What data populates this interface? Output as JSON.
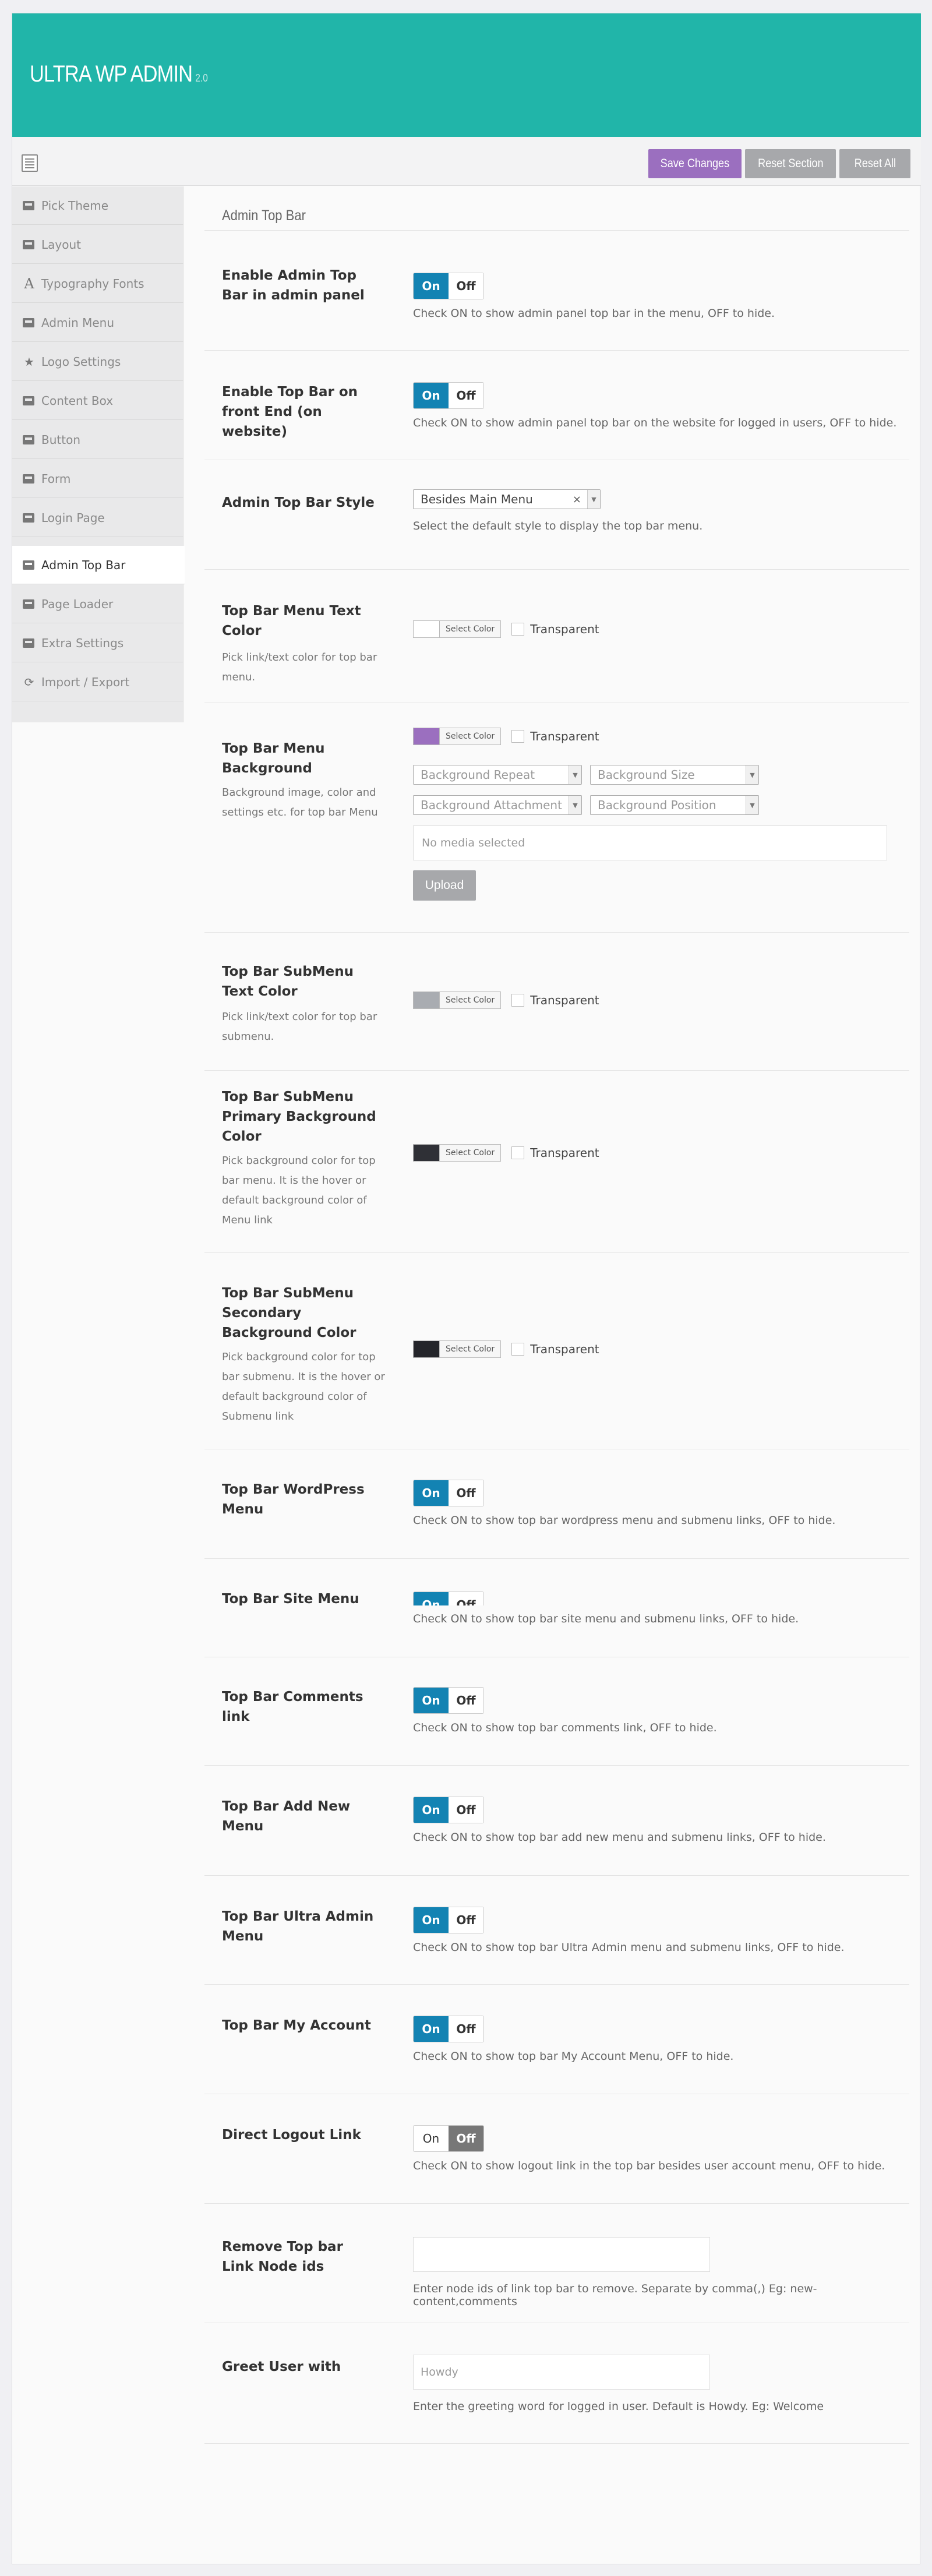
{
  "header": {
    "title": "ULTRA WP ADMIN",
    "version": "2.0"
  },
  "toolbar": {
    "save_label": "Save Changes",
    "reset_section_label": "Reset Section",
    "reset_all_label": "Reset All"
  },
  "sidebar": {
    "items": [
      {
        "label": "Pick Theme",
        "icon": "screen-icon"
      },
      {
        "label": "Layout",
        "icon": "screen-icon"
      },
      {
        "label": "Typography Fonts",
        "icon": "font-icon"
      },
      {
        "label": "Admin Menu",
        "icon": "screen-icon"
      },
      {
        "label": "Logo Settings",
        "icon": "star-icon"
      },
      {
        "label": "Content Box",
        "icon": "screen-icon"
      },
      {
        "label": "Button",
        "icon": "screen-icon"
      },
      {
        "label": "Form",
        "icon": "screen-icon"
      },
      {
        "label": "Login Page",
        "icon": "screen-icon"
      },
      {
        "label": "Admin Top Bar",
        "icon": "screen-icon",
        "active": true
      },
      {
        "label": "Page Loader",
        "icon": "screen-icon"
      },
      {
        "label": "Extra Settings",
        "icon": "screen-icon"
      },
      {
        "label": "Import / Export",
        "icon": "refresh-icon"
      }
    ]
  },
  "main": {
    "section_title": "Admin Top Bar",
    "fields": {
      "enable_admin": {
        "label": "Enable Admin Top Bar in admin panel",
        "help": "Check ON to show admin panel top bar in the menu, OFF to hide.",
        "on": "On",
        "off": "Off",
        "state": "on"
      },
      "enable_front": {
        "label": "Enable Top Bar on front End (on website)",
        "help": "Check ON to show admin panel top bar on the website for logged in users, OFF to hide.",
        "on": "On",
        "off": "Off",
        "state": "on"
      },
      "style": {
        "label": "Admin Top Bar Style",
        "value": "Besides Main Menu",
        "help": "Select the default style to display the top bar menu."
      },
      "menu_text_color": {
        "label": "Top Bar Menu Text Color",
        "desc": "Pick link/text color for top bar menu.",
        "color": "#ffffff",
        "select": "Select Color",
        "transparent": "Transparent"
      },
      "menu_bg": {
        "label": "Top Bar Menu Background",
        "desc": "Background image, color and settings etc. for top bar Menu",
        "color": "#9b6fbf",
        "select": "Select Color",
        "transparent": "Transparent",
        "repeat": "Background Repeat",
        "size": "Background Size",
        "attachment": "Background Attachment",
        "position": "Background Position",
        "media": "No media selected",
        "upload": "Upload"
      },
      "submenu_text": {
        "label": "Top Bar SubMenu Text Color",
        "desc": "Pick link/text color for top bar submenu.",
        "color": "#a9acb1",
        "select": "Select Color",
        "transparent": "Transparent"
      },
      "submenu_primary": {
        "label": "Top Bar SubMenu Primary Background Color",
        "desc": "Pick background color for top bar menu. It is the hover or default background color of Menu link",
        "color": "#2f3036",
        "select": "Select Color",
        "transparent": "Transparent"
      },
      "submenu_secondary": {
        "label": "Top Bar SubMenu Secondary Background Color",
        "desc": "Pick background color for top bar submenu. It is the hover or default background color of Submenu link",
        "color": "#24252a",
        "select": "Select Color",
        "transparent": "Transparent"
      },
      "wp_menu": {
        "label": "Top Bar WordPress Menu",
        "help": "Check ON to show top bar wordpress menu and submenu links, OFF to hide.",
        "on": "On",
        "off": "Off"
      },
      "site_menu": {
        "label": "Top Bar Site Menu",
        "help": "Check ON to show top bar site menu and submenu links, OFF to hide.",
        "on": "On",
        "off": "Off"
      },
      "comments": {
        "label": "Top Bar Comments link",
        "help": "Check ON to show top bar comments link, OFF to hide.",
        "on": "On",
        "off": "Off"
      },
      "add_new": {
        "label": "Top Bar Add New Menu",
        "help": "Check ON to show top bar add new menu and submenu links, OFF to hide.",
        "on": "On",
        "off": "Off"
      },
      "ultra_admin": {
        "label": "Top Bar Ultra Admin Menu",
        "help": "Check ON to show top bar Ultra Admin menu and submenu links, OFF to hide.",
        "on": "On",
        "off": "Off"
      },
      "my_account": {
        "label": "Top Bar My Account",
        "help": "Check ON to show top bar My Account Menu, OFF to hide.",
        "on": "On",
        "off": "Off"
      },
      "logout": {
        "label": "Direct Logout Link",
        "help": "Check ON to show logout link in the top bar besides user account menu, OFF to hide.",
        "on": "On",
        "off": "Off",
        "state": "off"
      },
      "remove_nodes": {
        "label": "Remove Top bar Link Node ids",
        "value": "",
        "help": "Enter node ids of link top bar to remove. Separate by comma(,) Eg: new-content,comments"
      },
      "greet": {
        "label": "Greet User with",
        "placeholder": "Howdy",
        "help": "Enter the greeting word for logged in user. Default is Howdy. Eg: Welcome"
      }
    }
  }
}
